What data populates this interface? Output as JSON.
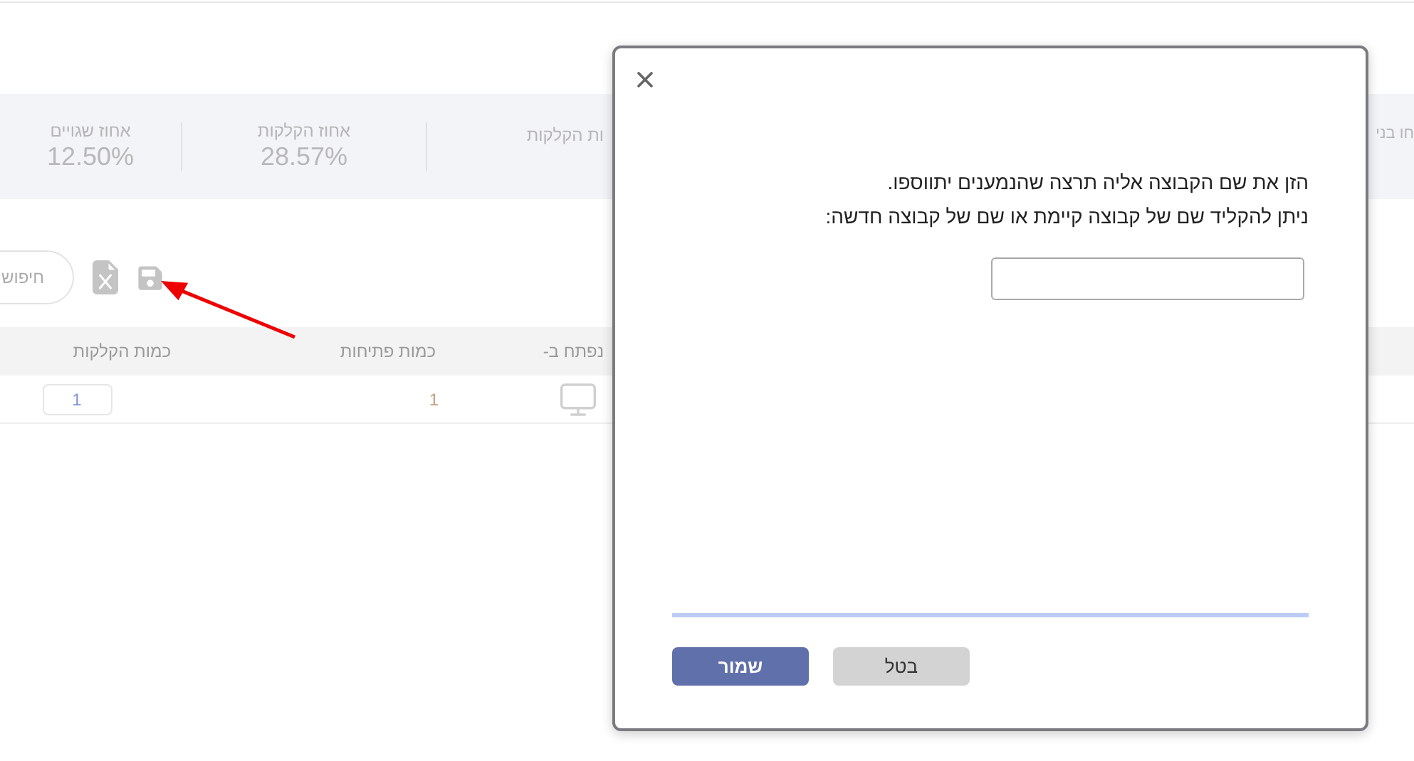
{
  "stats": [
    {
      "label": "חו בני"
    },
    {
      "label": "ות הקלקות"
    },
    {
      "label": "אחוז הקלקות",
      "value": "28.57%"
    },
    {
      "label": "אחוז שגויים",
      "value": "12.50%"
    }
  ],
  "search": {
    "placeholder": "חיפוש"
  },
  "table": {
    "columns": [
      "נפתח ב-",
      "כמות פתיחות",
      "כמות הקלקות"
    ],
    "rows": [
      {
        "opens": "1",
        "clicks": "1"
      }
    ]
  },
  "dialog": {
    "message_lines": [
      "הזן את שם הקבוצה אליה תרצה שהנמענים יתווספו.",
      "ניתן להקליד שם של קבוצה קיימת או שם של קבוצה חדשה:"
    ],
    "buttons": [
      {
        "label": "בטל",
        "kind": "secondary"
      },
      {
        "label": "שמור",
        "kind": "primary"
      }
    ]
  }
}
